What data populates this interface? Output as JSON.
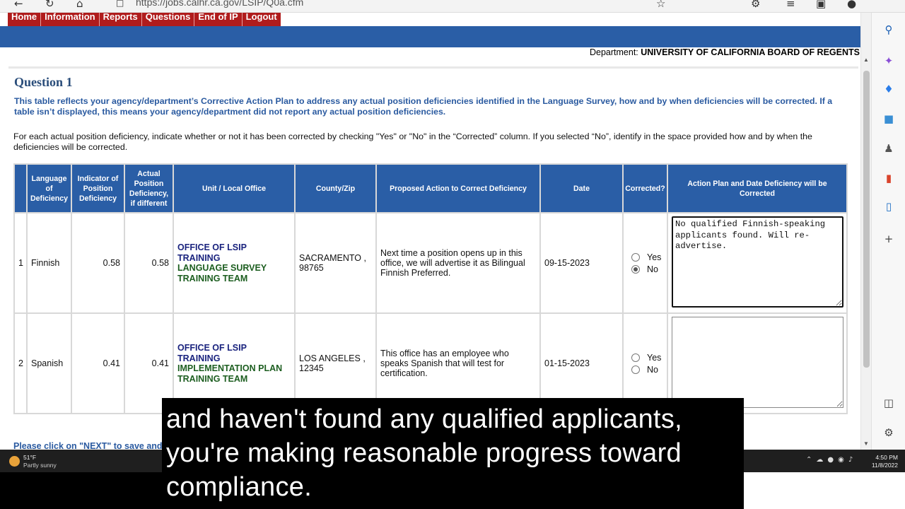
{
  "browser": {
    "url": "https://jobs.calhr.ca.gov/LSIP/Q0a.cfm"
  },
  "nav": [
    "Home",
    "Information",
    "Reports",
    "Questions",
    "End of IP",
    "Logout"
  ],
  "department": {
    "label": "Department:",
    "name": "UNIVERSITY OF CALIFORNIA BOARD OF REGENTS"
  },
  "question": {
    "title": "Question 1",
    "intro": "This table reflects your agency/department’s Corrective Action Plan to address any actual position deficiencies identified in the Language Survey, how and by when deficiencies will be corrected. If a table isn’t displayed, this means your agency/department did not report any actual position deficiencies.",
    "instructions": "For each actual position deficiency, indicate whether or not it has been corrected by checking \"Yes\" or \"No\" in the “Corrected” column. If you selected “No”, identify in the space provided how and by when the deficiencies will be corrected."
  },
  "table": {
    "headers": {
      "language": "Language of Deficiency",
      "indicator": "Indicator of Position Deficiency",
      "actual": "Actual Position Deficiency, if different",
      "unit": "Unit / Local Office",
      "county": "County/Zip",
      "action": "Proposed Action to Correct Deficiency",
      "date": "Date",
      "corrected": "Corrected?",
      "plan": "Action Plan and Date Deficiency will be Corrected"
    },
    "yes_label": "Yes",
    "no_label": "No",
    "rows": [
      {
        "index": "1",
        "language": "Finnish",
        "indicator": "0.58",
        "actual": "0.58",
        "unit_a": "OFFICE OF LSIP TRAINING",
        "unit_b": "LANGUAGE SURVEY TRAINING TEAM",
        "county": "SACRAMENTO , 98765",
        "action": "Next time a position opens up in this office, we will advertise it as Bilingual Finnish Preferred.",
        "date": "09-15-2023",
        "corrected": "No",
        "plan": "No qualified Finnish-speaking applicants found. Will re-advertise."
      },
      {
        "index": "2",
        "language": "Spanish",
        "indicator": "0.41",
        "actual": "0.41",
        "unit_a": "OFFICE OF LSIP TRAINING",
        "unit_b": "IMPLEMENTATION PLAN TRAINING TEAM",
        "county": "LOS ANGELES , 12345",
        "action": "This office has an employee who speaks Spanish that will test for certification.",
        "date": "01-15-2023",
        "corrected": "",
        "plan": ""
      }
    ]
  },
  "footer_note": "Please click on \"NEXT\" to save and",
  "taskbar": {
    "temp": "51°F",
    "weather": "Partly sunny",
    "time": "4:50 PM",
    "date": "11/8/2022"
  },
  "caption": [
    "and haven't found any qualified applicants,",
    "you're making reasonable progress toward",
    "compliance."
  ]
}
